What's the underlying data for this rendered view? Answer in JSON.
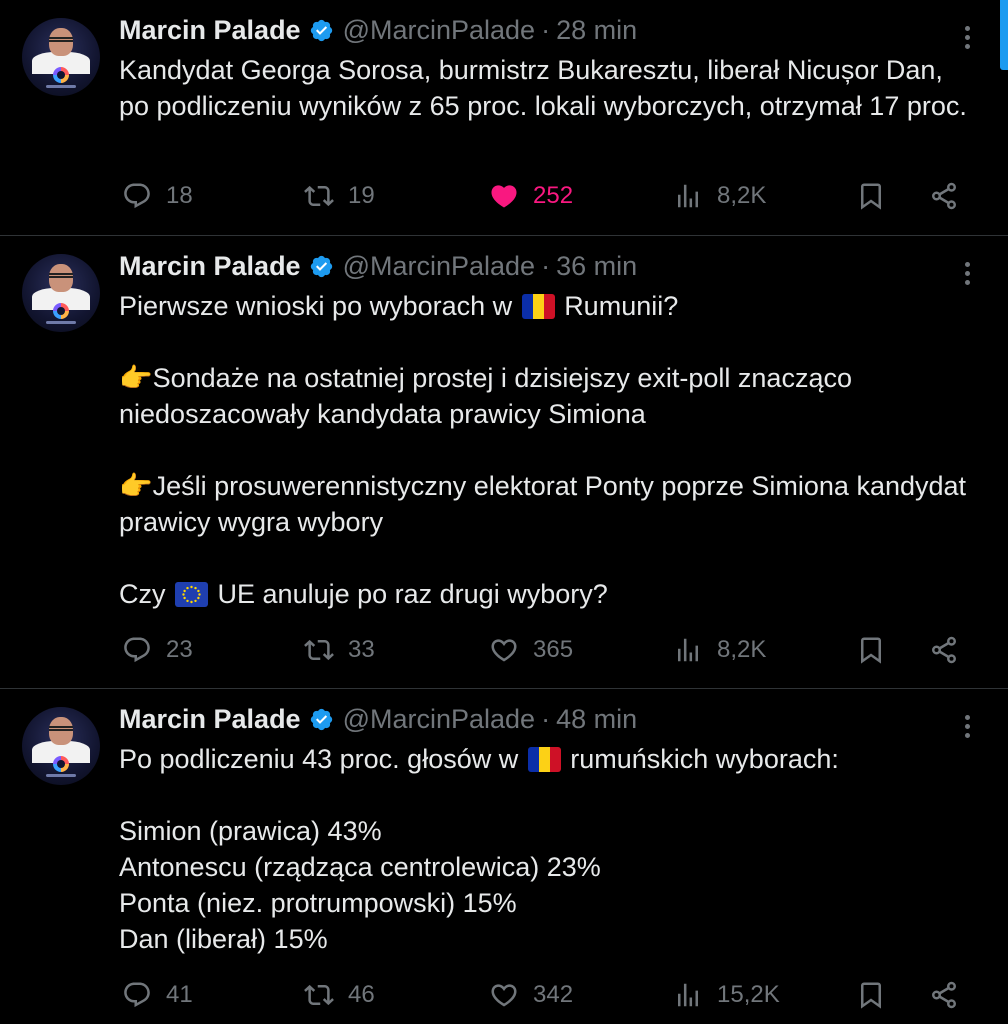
{
  "colors": {
    "background": "#000000",
    "text": "#e7e9ea",
    "muted": "#71767b",
    "verified": "#1d9bf0",
    "like_active": "#f91880",
    "divider": "#2f3336"
  },
  "icons": {
    "reply": "reply-icon",
    "retweet": "retweet-icon",
    "like": "heart-icon",
    "views": "views-chart-icon",
    "bookmark": "bookmark-icon",
    "share": "share-icon",
    "more": "more-options-icon",
    "verified": "verified-badge-icon"
  },
  "tweets": [
    {
      "author": {
        "name": "Marcin Palade",
        "handle": "@MarcinPalade"
      },
      "dot": "·",
      "time": "28 min",
      "text": {
        "line1": "Kandydat Georga Sorosa, burmistrz Bukaresztu, liberał Nicușor Dan, po podliczeniu wyników z 65 proc. lokali wyborczych, otrzymał 17 proc."
      },
      "stats": {
        "replies": "18",
        "retweets": "19",
        "likes": "252",
        "views": "8,2K"
      },
      "liked": true
    },
    {
      "author": {
        "name": "Marcin Palade",
        "handle": "@MarcinPalade"
      },
      "dot": "·",
      "time": "36 min",
      "text": {
        "p1_before": "Pierwsze wnioski po wyborach w",
        "p1_after": "Rumunii?",
        "p2": "👉Sondaże na ostatniej prostej i dzisiejszy exit-poll znacząco niedoszacowały kandydata prawicy Simiona",
        "p3": "👉Jeśli prosuwerennistyczny elektorat Ponty poprze Simiona kandydat prawicy wygra wybory",
        "p4_before": "Czy",
        "p4_after": "UE anuluje po raz drugi wybory?"
      },
      "stats": {
        "replies": "23",
        "retweets": "33",
        "likes": "365",
        "views": "8,2K"
      },
      "liked": false
    },
    {
      "author": {
        "name": "Marcin Palade",
        "handle": "@MarcinPalade"
      },
      "dot": "·",
      "time": "48 min",
      "text": {
        "p1_before": "Po podliczeniu 43 proc. głosów w",
        "p1_after": "rumuńskich wyborach:",
        "r1": "Simion (prawica) 43%",
        "r2": "Antonescu (rządząca centrolewica) 23%",
        "r3": "Ponta (niez. protrumpowski) 15%",
        "r4": "Dan (liberał) 15%"
      },
      "stats": {
        "replies": "41",
        "retweets": "46",
        "likes": "342",
        "views": "15,2K"
      },
      "liked": false
    }
  ]
}
